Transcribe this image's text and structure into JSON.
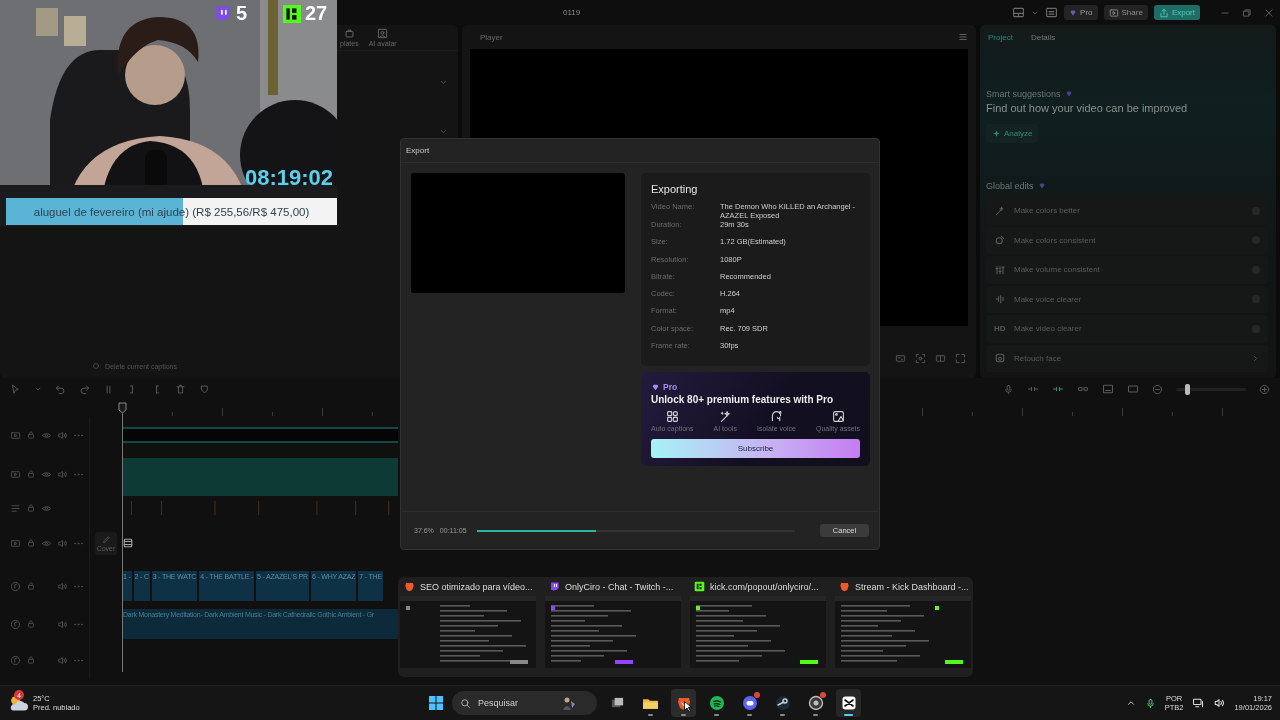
{
  "app": {
    "title": "0119",
    "top_buttons": [
      {
        "kind": "pro",
        "label": "Pro"
      },
      {
        "kind": "share",
        "label": "Share"
      },
      {
        "kind": "export",
        "label": "Export"
      }
    ]
  },
  "webcam": {
    "twitch_count": "5",
    "kick_count": "27",
    "timer": "08:19:02",
    "goal": {
      "label": "aluguel de fevereiro (mi ajude) (R$ 255,56/R$ 475,00)",
      "level": 0.535
    }
  },
  "media_panel": {
    "tabs": [
      {
        "label": "plates",
        "selected": false
      },
      {
        "label": "AI avatar",
        "selected": false
      }
    ],
    "caption_action": "Delete current captions"
  },
  "player": {
    "title": "Player"
  },
  "details_panel": {
    "tabs": [
      {
        "label": "Project",
        "selected": true
      },
      {
        "label": "Details",
        "selected": false
      }
    ],
    "suggestions_title": "Smart suggestions",
    "suggestions_text": "Find out how your video can be improved",
    "analyze_button": "Analyze",
    "global_title": "Global edits",
    "edits": [
      {
        "kind": "toggle",
        "label": "Make colors better",
        "on": false
      },
      {
        "kind": "toggle",
        "label": "Make colors consistent",
        "on": false
      },
      {
        "kind": "toggle",
        "label": "Make volume consistent",
        "on": false
      },
      {
        "kind": "toggle",
        "label": "Make voice clearer",
        "on": false
      },
      {
        "kind": "toggle",
        "label": "Make video clearer",
        "on": false,
        "icon_text": "HD"
      },
      {
        "kind": "link",
        "label": "Retouch face"
      }
    ]
  },
  "timeline": {
    "tracks": [
      {
        "kind": "video"
      },
      {
        "kind": "video"
      },
      {
        "kind": "text"
      },
      {
        "kind": "video",
        "cover_label": "Cover"
      },
      {
        "kind": "audio",
        "segments": [
          "1 -",
          "2 - C",
          "3 - THE WATC",
          "4 - THE BATTLE -",
          "5 - AZAZEL'S PR",
          "6 - WHY AZAZ",
          "7 - THE"
        ]
      },
      {
        "kind": "audio",
        "clip_title": "Dark Monastery Meditation- Dark Ambient Music - Dark Cathedralic Gothic Ambient - Gr"
      },
      {
        "kind": "audio"
      }
    ],
    "zoom": {
      "level": 0.15
    }
  },
  "export_dialog": {
    "title": "Export",
    "status_title": "Exporting",
    "details": [
      {
        "label": "Video Name:",
        "value": "The Demon Who KILLED an Archangel - AZAZEL Exposed"
      },
      {
        "label": "Duration:",
        "value": "29m 30s"
      },
      {
        "label": "Size:",
        "value": "1.72 GB(Estimated)"
      },
      {
        "label": "Resolution:",
        "value": "1080P"
      },
      {
        "label": "Bitrate:",
        "value": "Recommended"
      },
      {
        "label": "Codec:",
        "value": "H.264"
      },
      {
        "label": "Format:",
        "value": "mp4"
      },
      {
        "label": "Color space:",
        "value": "Rec. 709 SDR"
      },
      {
        "label": "Frame rate:",
        "value": "30fps"
      }
    ],
    "promo": {
      "badge": "Pro",
      "headline": "Unlock 80+ premium features with Pro",
      "features": [
        "Auto captions",
        "AI tools",
        "Isolate voice",
        "Quality assets"
      ],
      "button": "Subscribe"
    },
    "progress": {
      "percent": "37.6%",
      "elapsed": "00:11:05",
      "level": 0.376
    },
    "cancel_button": "Cancel"
  },
  "task_previews": [
    {
      "kind": "brave",
      "title": "SEO otimizado para vídeo..."
    },
    {
      "kind": "twitch",
      "title": "OnlyCiro - Chat - Twitch -..."
    },
    {
      "kind": "kick",
      "title": "kick.com/popout/onlyciro/..."
    },
    {
      "kind": "brave",
      "title": "Stream - Kick Dashboard -..."
    }
  ],
  "taskbar": {
    "weather": {
      "temperature": "25°C",
      "forecast": "Pred. nublado",
      "badge": "4"
    },
    "search": {
      "placeholder": "Pesquisar"
    },
    "apps": [
      {
        "kind": "taskview",
        "running": false,
        "focused": false,
        "hovered": false,
        "notified": false
      },
      {
        "kind": "files",
        "running": true,
        "focused": false,
        "hovered": false,
        "notified": false
      },
      {
        "kind": "brave",
        "running": true,
        "focused": false,
        "hovered": true,
        "notified": false
      },
      {
        "kind": "spotify",
        "running": true,
        "focused": false,
        "hovered": false,
        "notified": false
      },
      {
        "kind": "discord",
        "running": true,
        "focused": false,
        "hovered": false,
        "notified": true
      },
      {
        "kind": "steam",
        "running": true,
        "focused": false,
        "hovered": false,
        "notified": false
      },
      {
        "kind": "recorder",
        "running": true,
        "focused": false,
        "hovered": false,
        "notified": true
      },
      {
        "kind": "editor",
        "running": true,
        "focused": true,
        "hovered": false,
        "notified": false
      }
    ],
    "tray": {
      "language": "POR",
      "layout": "PTB2",
      "time": "19:17",
      "date": "19/01/2026"
    }
  }
}
